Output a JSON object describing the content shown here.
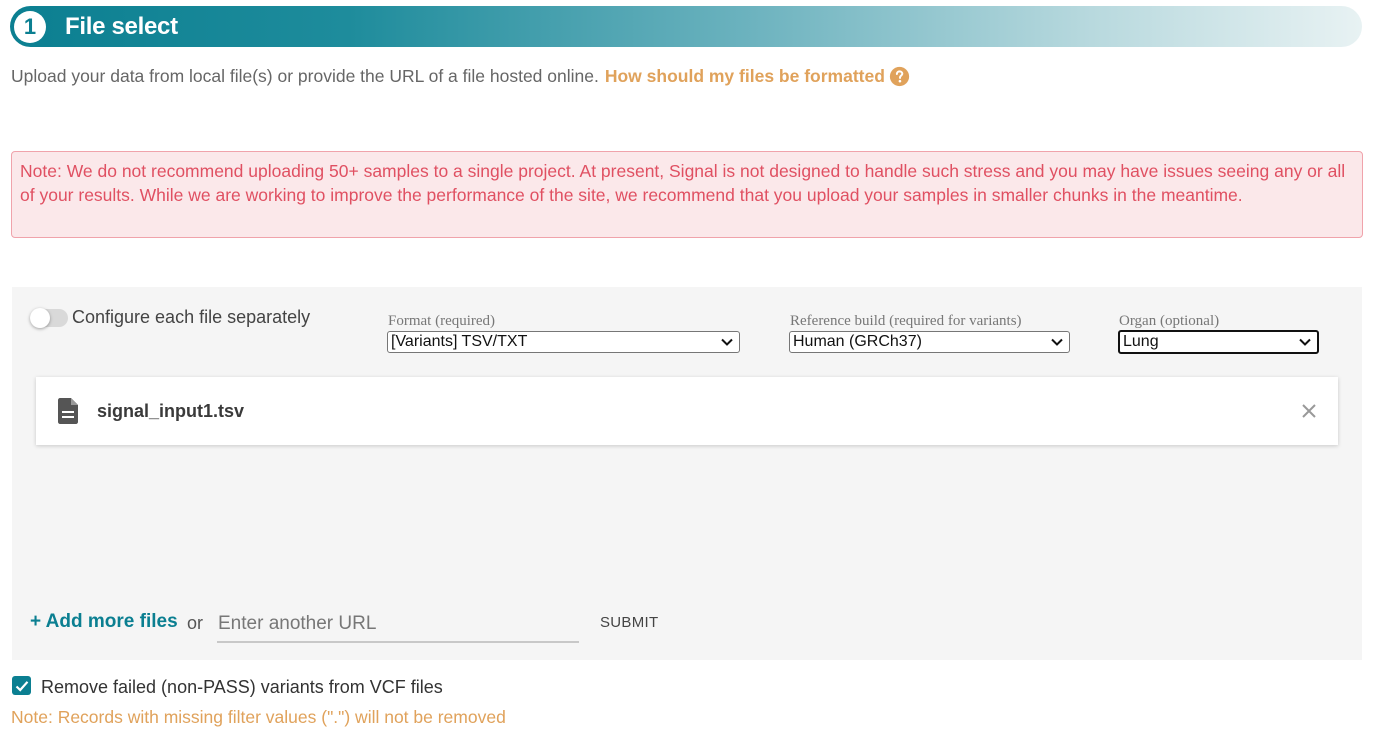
{
  "header": {
    "step": "1",
    "title": "File select"
  },
  "intro": {
    "text": "Upload your data from local file(s) or provide the URL of a file hosted online.",
    "link": "How should my files be formatted"
  },
  "warning": "Note: We do not recommend uploading 50+ samples to a single project. At present, Signal is not designed to handle such stress and you may have issues seeing any or all of your results. While we are working to improve the performance of the site, we recommend that you upload your samples in smaller chunks in the meantime.",
  "config": {
    "toggle_label": "Configure each file separately",
    "format": {
      "label": "Format (required)",
      "value": "[Variants] TSV/TXT"
    },
    "reference": {
      "label": "Reference build (required for variants)",
      "value": "Human (GRCh37)"
    },
    "organ": {
      "label": "Organ (optional)",
      "value": "Lung"
    }
  },
  "files": [
    {
      "name": "signal_input1.tsv"
    }
  ],
  "add": {
    "add_more": "+ Add more files",
    "or": "or",
    "url_placeholder": "Enter another URL",
    "submit": "SUBMIT"
  },
  "filter": {
    "checkbox_label": "Remove failed (non-PASS) variants from VCF files",
    "checked": true,
    "note": "Note: Records with missing filter values (\".\") will not be removed"
  },
  "colors": {
    "teal": "#0b7f91",
    "orange_link": "#e0a25b",
    "warning_text": "#e05062",
    "warning_bg": "#fbe8ea"
  }
}
